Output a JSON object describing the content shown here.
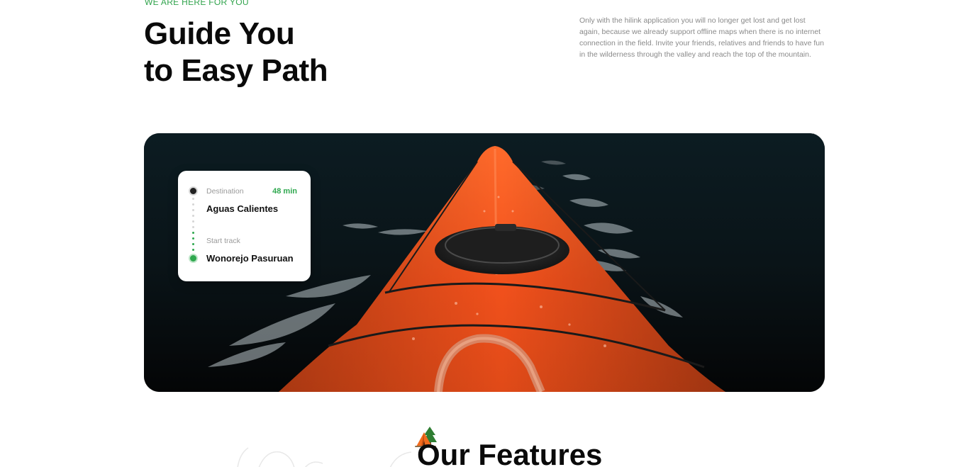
{
  "hero": {
    "eyebrow": "WE ARE HERE FOR YOU",
    "title_line1": "Guide You",
    "title_line2": "to Easy Path",
    "description": "Only with the hilink application you will no longer get lost and get lost again, because we already support offline maps when there is no internet connection in the field. Invite your friends, relatives and friends to have fun in the wilderness through the valley and reach the top of the mountain."
  },
  "banner": {
    "image": "kayak-on-lake-photo"
  },
  "route_card": {
    "destination_label": "Destination",
    "destination_name": "Aguas Calientes",
    "eta": "48 min",
    "start_label": "Start track",
    "start_name": "Wonorejo Pasuruan"
  },
  "features": {
    "title": "Our Features",
    "icon": "tent-icon"
  },
  "colors": {
    "accent_green": "#2fa84f",
    "kayak_orange": "#f05a22",
    "water_dark": "#07090b",
    "text_dark": "#0a0a0a",
    "text_muted": "#8a8a8a"
  }
}
